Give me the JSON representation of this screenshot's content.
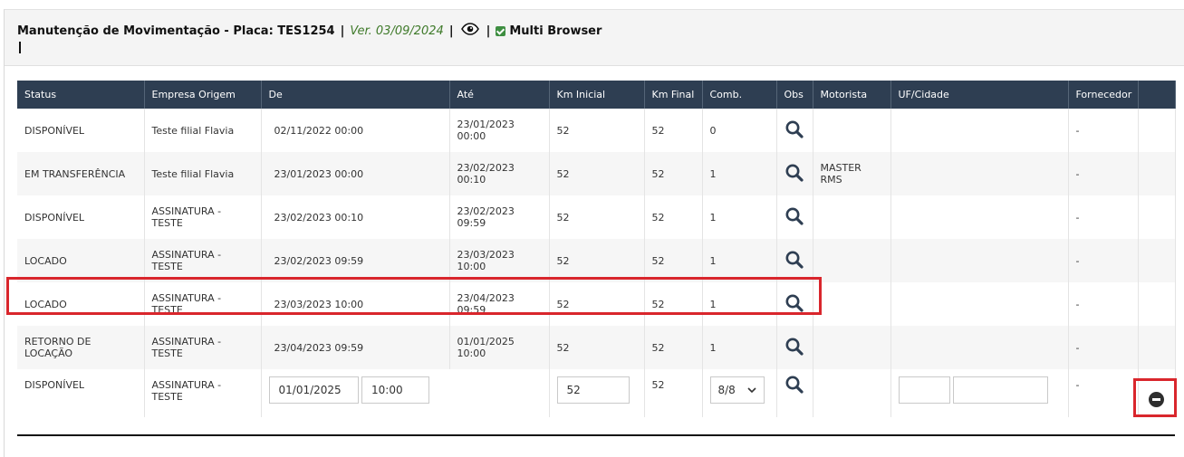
{
  "header": {
    "title": "Manutenção de Movimentação - Placa: TES1254",
    "separator": "|",
    "version": "Ver. 03/09/2024",
    "multi_browser_label": "Multi Browser"
  },
  "table": {
    "columns": [
      "Status",
      "Empresa Origem",
      "De",
      "Até",
      "Km Inicial",
      "Km Final",
      "Comb.",
      "Obs",
      "Motorista",
      "UF/Cidade",
      "Fornecedor",
      ""
    ],
    "rows": [
      {
        "status": "DISPONÍVEL",
        "empresa": "Teste filial Flavia",
        "de": "02/11/2022 00:00",
        "ate": "23/01/2023 00:00",
        "km_inicial": "52",
        "km_final": "52",
        "comb": "0",
        "motorista": "",
        "uf_cidade": "",
        "fornecedor": "-"
      },
      {
        "status": "EM TRANSFERÊNCIA",
        "empresa": "Teste filial Flavia",
        "de": "23/01/2023 00:00",
        "ate": "23/02/2023 00:10",
        "km_inicial": "52",
        "km_final": "52",
        "comb": "1",
        "motorista": "MASTER RMS",
        "uf_cidade": "",
        "fornecedor": "-"
      },
      {
        "status": "DISPONÍVEL",
        "empresa": "ASSINATURA - TESTE",
        "de": "23/02/2023 00:10",
        "ate": "23/02/2023 09:59",
        "km_inicial": "52",
        "km_final": "52",
        "comb": "1",
        "motorista": "",
        "uf_cidade": "",
        "fornecedor": "-"
      },
      {
        "status": "LOCADO",
        "empresa": "ASSINATURA - TESTE",
        "de": "23/02/2023 09:59",
        "ate": "23/03/2023 10:00",
        "km_inicial": "52",
        "km_final": "52",
        "comb": "1",
        "motorista": "",
        "uf_cidade": "",
        "fornecedor": "-"
      },
      {
        "status": "LOCADO",
        "empresa": "ASSINATURA - TESTE",
        "de": "23/03/2023 10:00",
        "ate": "23/04/2023 09:59",
        "km_inicial": "52",
        "km_final": "52",
        "comb": "1",
        "motorista": "",
        "uf_cidade": "",
        "fornecedor": "-"
      },
      {
        "status": "RETORNO DE LOCAÇÃO",
        "empresa": "ASSINATURA - TESTE",
        "de": "23/04/2023 09:59",
        "ate": "01/01/2025 10:00",
        "km_inicial": "52",
        "km_final": "52",
        "comb": "1",
        "motorista": "",
        "uf_cidade": "",
        "fornecedor": "-"
      }
    ],
    "edit_row": {
      "status": "DISPONÍVEL",
      "empresa": "ASSINATURA - TESTE",
      "date_value": "01/01/2025",
      "time_value": "10:00",
      "km_inicial_value": "52",
      "km_final": "52",
      "comb_selected": "8/8",
      "uf_value": "",
      "cidade_value": "",
      "fornecedor": "-"
    }
  },
  "icons": {
    "view": "eye-icon",
    "obs": "search-icon",
    "remove": "remove-circle-icon",
    "checkbox": "checkbox-checked-icon"
  },
  "colors": {
    "header_bg": "#2e3e52",
    "version_text": "#3f7a2a",
    "highlight_border": "#d9262c"
  }
}
